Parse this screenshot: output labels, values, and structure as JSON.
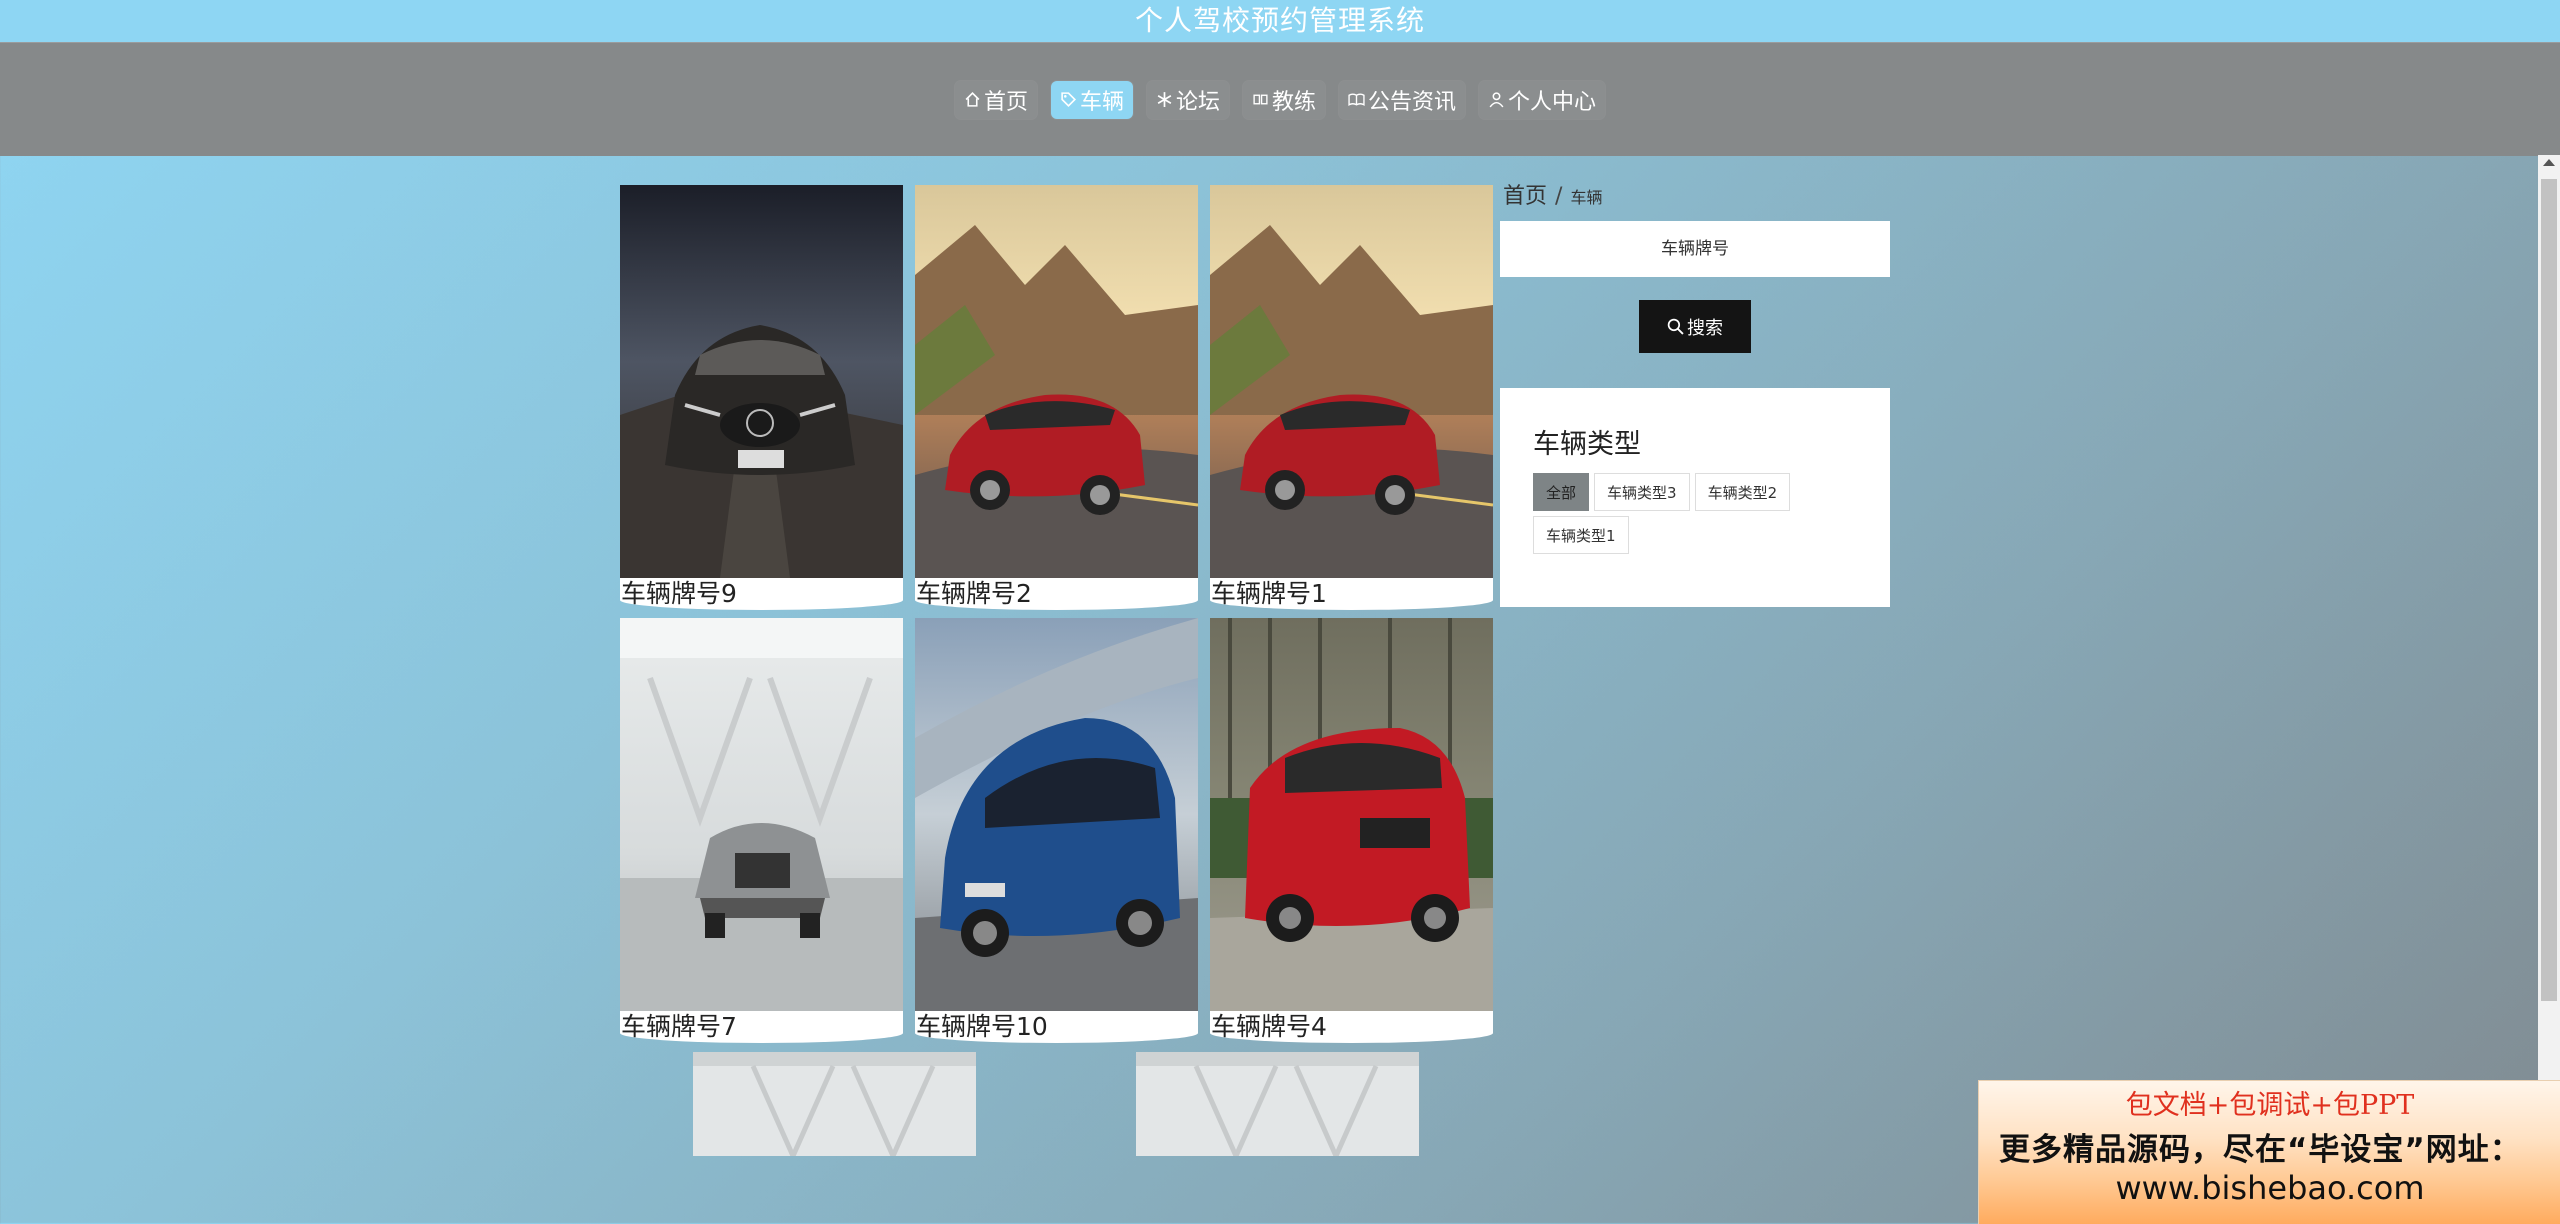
{
  "app": {
    "title": "个人驾校预约管理系统"
  },
  "nav": {
    "items": [
      {
        "label": "首页",
        "icon": "home-icon"
      },
      {
        "label": "车辆",
        "icon": "tag-icon",
        "active": true
      },
      {
        "label": "论坛",
        "icon": "snowflake-icon"
      },
      {
        "label": "教练",
        "icon": "users-icon"
      },
      {
        "label": "公告资讯",
        "icon": "book-icon"
      },
      {
        "label": "个人中心",
        "icon": "user-icon"
      }
    ],
    "active_color": "#8ed6f3"
  },
  "breadcrumb": {
    "home": "首页",
    "separator": "/",
    "current": "车辆"
  },
  "search": {
    "placeholder": "车辆牌号",
    "button_label": "搜索"
  },
  "vehicle_types": {
    "title": "车辆类型",
    "tags": [
      "全部",
      "车辆类型3",
      "车辆类型2",
      "车辆类型1"
    ],
    "active": "全部"
  },
  "vehicles": [
    {
      "name": "车辆牌号9",
      "image": "dark-mercedes-suv-storm"
    },
    {
      "name": "车辆牌号2",
      "image": "red-sedan-mountain-road"
    },
    {
      "name": "车辆牌号1",
      "image": "red-sedan-mountain-road"
    },
    {
      "name": "车辆牌号7",
      "image": "silver-convertible-white-room"
    },
    {
      "name": "车辆牌号10",
      "image": "blue-wagon-motion"
    },
    {
      "name": "车辆牌号4",
      "image": "red-suv-forest"
    }
  ],
  "partial_thumbnails": [
    "white-room-interior",
    "white-room-interior"
  ],
  "ad": {
    "line1": "包文档+包调试+包PPT",
    "line2": "更多精品源码，尽在“毕设宝”网址：",
    "line3": "www.bishebao.com"
  }
}
